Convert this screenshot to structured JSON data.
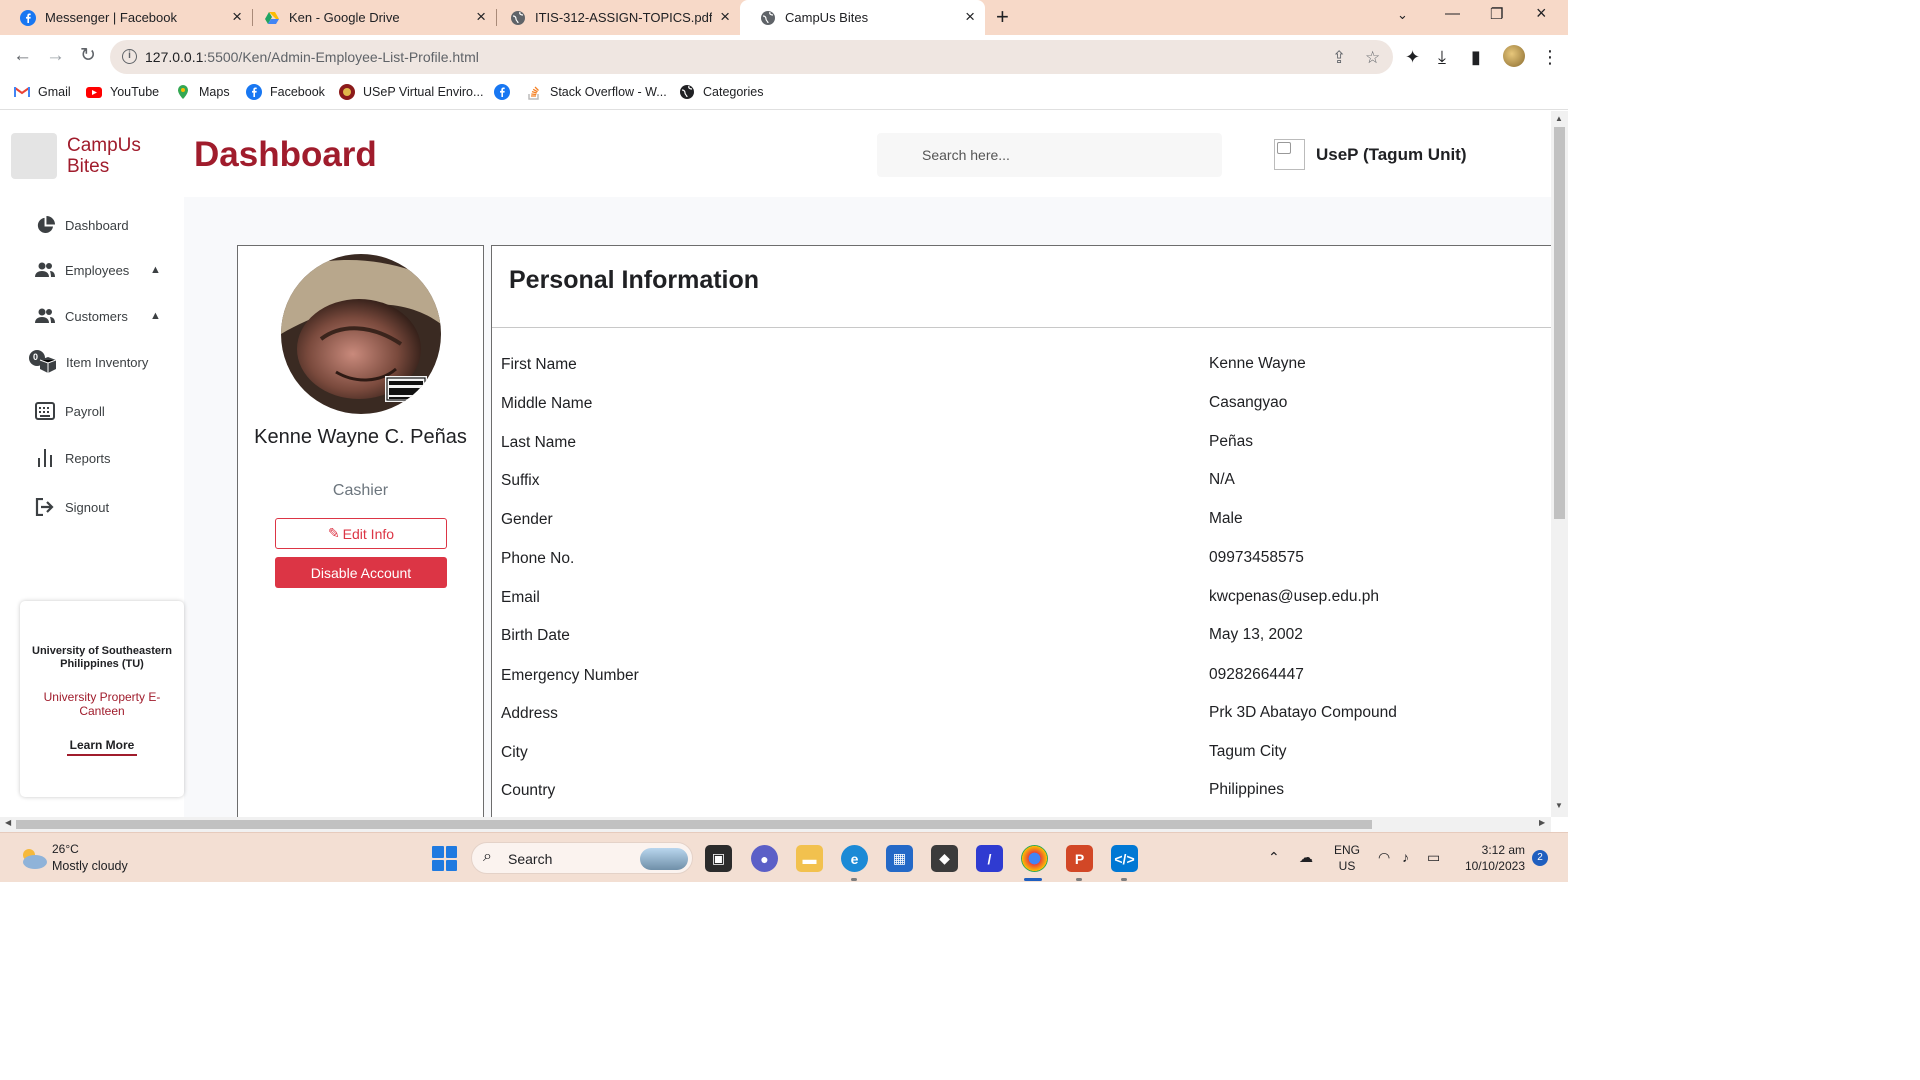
{
  "browser": {
    "tabs": [
      {
        "title": "Messenger | Facebook",
        "icon": "facebook-icon",
        "color": "#1877f2"
      },
      {
        "title": "Ken - Google Drive",
        "icon": "google-drive-icon",
        "color": "#1fa463"
      },
      {
        "title": "ITIS-312-ASSIGN-TOPICS.pdf",
        "icon": "globe-icon",
        "color": "#5f6368"
      },
      {
        "title": "CampUs Bites",
        "icon": "globe-icon",
        "color": "#5f6368",
        "active": true
      }
    ],
    "url_host": "127.0.0.1",
    "url_path": ":5500/Ken/Admin-Employee-List-Profile.html",
    "bookmarks": [
      {
        "label": "Gmail",
        "icon": "gmail-icon",
        "color": "#ea4335"
      },
      {
        "label": "YouTube",
        "icon": "youtube-icon",
        "color": "#ff0000"
      },
      {
        "label": "Maps",
        "icon": "maps-icon",
        "color": "#34a853"
      },
      {
        "label": "Facebook",
        "icon": "facebook-icon",
        "color": "#1877f2"
      },
      {
        "label": "USeP Virtual Enviro...",
        "icon": "usep-icon",
        "color": "#8b1a1a"
      },
      {
        "label": "",
        "icon": "facebook-icon",
        "color": "#1877f2"
      },
      {
        "label": "Stack Overflow - W...",
        "icon": "stackoverflow-icon",
        "color": "#f48024"
      },
      {
        "label": "Categories",
        "icon": "globe-icon",
        "color": "#202124"
      }
    ]
  },
  "app": {
    "brand": "CampUs Bites",
    "page_title": "Dashboard",
    "search_placeholder": "Search here...",
    "unit_name": "UseP (Tagum Unit)",
    "accent_color": "#a01c2c"
  },
  "sidebar": {
    "items": [
      {
        "label": "Dashboard",
        "icon": "pie-chart-icon"
      },
      {
        "label": "Employees",
        "icon": "users-icon",
        "expandable": true
      },
      {
        "label": "Customers",
        "icon": "users-icon",
        "expandable": true
      },
      {
        "label": "Item Inventory",
        "icon": "inventory-icon",
        "badge": "0"
      },
      {
        "label": "Payroll",
        "icon": "keyboard-icon"
      },
      {
        "label": "Reports",
        "icon": "bar-chart-icon"
      },
      {
        "label": "Signout",
        "icon": "signout-icon"
      }
    ],
    "promo": {
      "university": "University of Southeastern Philippines (TU)",
      "subtitle": "University Property E-Canteen",
      "button": "Learn More"
    }
  },
  "profile": {
    "name": "Kenne Wayne C. Peñas",
    "role": "Cashier",
    "edit_label": "Edit Info",
    "disable_label": "Disable Account"
  },
  "personal_info": {
    "title": "Personal Information",
    "rows": [
      {
        "label": "First Name",
        "value": "Kenne Wayne"
      },
      {
        "label": "Middle Name",
        "value": "Casangyao"
      },
      {
        "label": "Last Name",
        "value": "Peñas"
      },
      {
        "label": "Suffix",
        "value": "N/A"
      },
      {
        "label": "Gender",
        "value": "Male"
      },
      {
        "label": "Phone No.",
        "value": "09973458575"
      },
      {
        "label": "Email",
        "value": "kwcpenas@usep.edu.ph"
      },
      {
        "label": "Birth Date",
        "value": "May 13, 2002"
      },
      {
        "label": "Emergency Number",
        "value": "09282664447"
      },
      {
        "label": "Address",
        "value": "Prk 3D Abatayo Compound"
      },
      {
        "label": "City",
        "value": "Tagum City"
      },
      {
        "label": "Country",
        "value": "Philippines"
      }
    ]
  },
  "taskbar": {
    "weather_temp": "26°C",
    "weather_desc": "Mostly cloudy",
    "search_label": "Search",
    "lang_line1": "ENG",
    "lang_line2": "US",
    "time": "3:12 am",
    "date": "10/10/2023",
    "notification_count": "2"
  }
}
